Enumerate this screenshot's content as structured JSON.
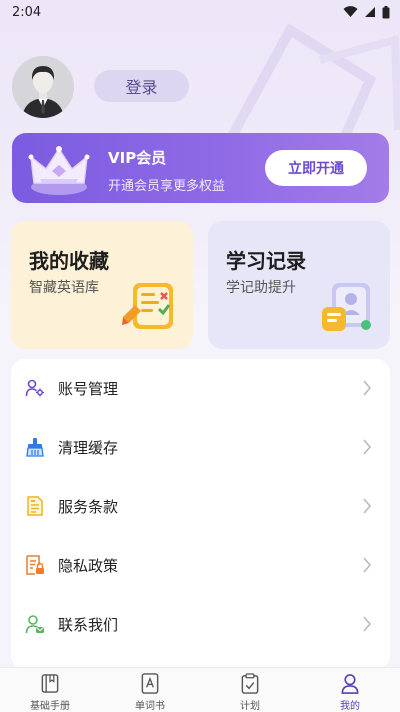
{
  "status_bar": {
    "time": "2:04"
  },
  "profile": {
    "login_label": "登录"
  },
  "vip": {
    "title": "VIP会员",
    "subtitle": "开通会员享更多权益",
    "button_label": "立即开通"
  },
  "cards": [
    {
      "title": "我的收藏",
      "subtitle": "智藏英语库"
    },
    {
      "title": "学习记录",
      "subtitle": "学记助提升"
    }
  ],
  "menu": {
    "items": [
      {
        "label": "账号管理",
        "icon": "account-icon"
      },
      {
        "label": "清理缓存",
        "icon": "broom-icon"
      },
      {
        "label": "服务条款",
        "icon": "document-icon"
      },
      {
        "label": "隐私政策",
        "icon": "privacy-icon"
      },
      {
        "label": "联系我们",
        "icon": "contact-icon"
      }
    ]
  },
  "bottom_nav": {
    "items": [
      {
        "label": "基础手册",
        "icon": "book-icon"
      },
      {
        "label": "单词书",
        "icon": "word-book-icon"
      },
      {
        "label": "计划",
        "icon": "clipboard-icon"
      },
      {
        "label": "我的",
        "icon": "user-icon"
      }
    ],
    "active_index": 3
  },
  "colors": {
    "accent": "#7b5be0",
    "fav_card": "#fdf2d7",
    "rec_card": "#e7e6f9"
  }
}
